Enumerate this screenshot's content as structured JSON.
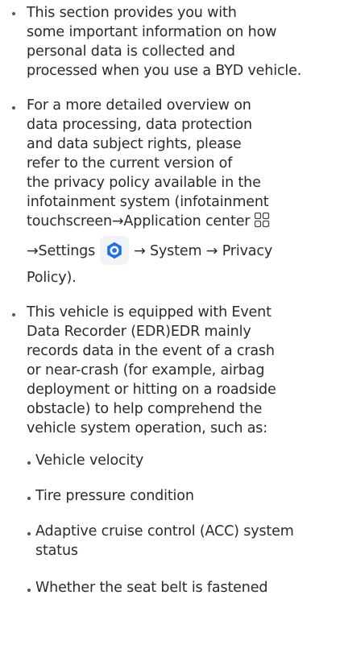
{
  "content": {
    "bullet1_lines": [
      "This section provides you with",
      "some important information on how",
      "personal data is collected and",
      "processed when you use a BYD vehicle."
    ],
    "bullet2_lines": [
      "For a more detailed overview on",
      "data processing, data protection",
      "and data subject rights, please",
      "refer to the current version of",
      "the privacy policy available in the",
      "infotainment system (infotainment",
      "touchscreen→Application center"
    ],
    "bullet2_settings_prefix": "→Settings",
    "bullet2_settings_suffix": "→ System → Privacy",
    "bullet2_end": "Policy).",
    "bullet3_lines": [
      "This vehicle is equipped with Event",
      "Data Recorder (EDR)EDR mainly",
      "records data in the event of a crash",
      "or near-crash (for example, airbag",
      "deployment or hitting on a roadside",
      "obstacle) to help comprehend the",
      "vehicle system operation, such as:"
    ],
    "sub_items": [
      "Vehicle velocity",
      "Tire pressure condition",
      "Adaptive cruise control (ACC) system status",
      "Whether the seat belt is fastened"
    ]
  },
  "icons": {
    "app_center": "app-center-grid-icon",
    "settings": "settings-gear-icon"
  },
  "colors": {
    "text": "#2b2b2b",
    "settings_icon_blue": "#1f6fe6",
    "settings_icon_bg": "#f2f3f5"
  }
}
